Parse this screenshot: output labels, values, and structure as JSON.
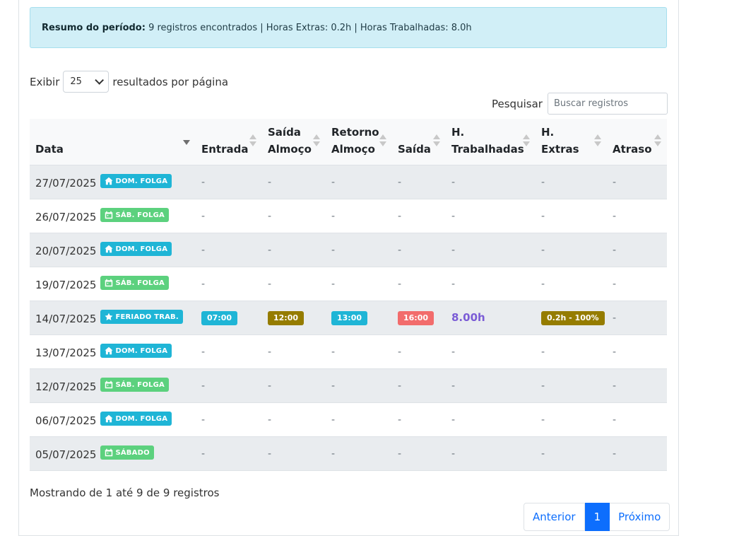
{
  "summary": {
    "label": "Resumo do período:",
    "text": " 9 registros encontrados | Horas Extras: 0.2h | Horas Trabalhadas: 8.0h"
  },
  "length_menu": {
    "before": "Exibir",
    "value": "25",
    "after": "resultados por página"
  },
  "search": {
    "label": "Pesquisar",
    "placeholder": "Buscar registros"
  },
  "columns": [
    {
      "line1": "",
      "line2": "Data"
    },
    {
      "line1": "",
      "line2": "Entrada"
    },
    {
      "line1": "Saída",
      "line2": "Almoço"
    },
    {
      "line1": "Retorno",
      "line2": "Almoço"
    },
    {
      "line1": "",
      "line2": "Saída"
    },
    {
      "line1": "H.",
      "line2": "Trabalhadas"
    },
    {
      "line1": "H.",
      "line2": "Extras"
    },
    {
      "line1": "",
      "line2": "Atraso"
    }
  ],
  "rows": [
    {
      "date": "27/07/2025",
      "tag": "DOM. FOLGA",
      "tag_icon": "home-icon",
      "tag_color": "#1fb5d6",
      "entrada": "-",
      "saida_almoco": "-",
      "retorno_almoco": "-",
      "saida": "-",
      "h_trabalhadas": "-",
      "h_extras": "-",
      "atraso": "-"
    },
    {
      "date": "26/07/2025",
      "tag": "SÁB. FOLGA",
      "tag_icon": "calendar-icon",
      "tag_color": "#5cd17e",
      "entrada": "-",
      "saida_almoco": "-",
      "retorno_almoco": "-",
      "saida": "-",
      "h_trabalhadas": "-",
      "h_extras": "-",
      "atraso": "-"
    },
    {
      "date": "20/07/2025",
      "tag": "DOM. FOLGA",
      "tag_icon": "home-icon",
      "tag_color": "#1fb5d6",
      "entrada": "-",
      "saida_almoco": "-",
      "retorno_almoco": "-",
      "saida": "-",
      "h_trabalhadas": "-",
      "h_extras": "-",
      "atraso": "-"
    },
    {
      "date": "19/07/2025",
      "tag": "SÁB. FOLGA",
      "tag_icon": "calendar-icon",
      "tag_color": "#5cd17e",
      "entrada": "-",
      "saida_almoco": "-",
      "retorno_almoco": "-",
      "saida": "-",
      "h_trabalhadas": "-",
      "h_extras": "-",
      "atraso": "-"
    },
    {
      "date": "14/07/2025",
      "tag": "FERIADO TRAB.",
      "tag_icon": "star-icon",
      "tag_color": "#1fb5d6",
      "entrada": "07:00",
      "saida_almoco": "12:00",
      "retorno_almoco": "13:00",
      "saida": "16:00",
      "h_trabalhadas": "8.00h",
      "h_extras": "0.2h - 100%",
      "atraso": "-"
    },
    {
      "date": "13/07/2025",
      "tag": "DOM. FOLGA",
      "tag_icon": "home-icon",
      "tag_color": "#1fb5d6",
      "entrada": "-",
      "saida_almoco": "-",
      "retorno_almoco": "-",
      "saida": "-",
      "h_trabalhadas": "-",
      "h_extras": "-",
      "atraso": "-"
    },
    {
      "date": "12/07/2025",
      "tag": "SÁB. FOLGA",
      "tag_icon": "calendar-icon",
      "tag_color": "#5cd17e",
      "entrada": "-",
      "saida_almoco": "-",
      "retorno_almoco": "-",
      "saida": "-",
      "h_trabalhadas": "-",
      "h_extras": "-",
      "atraso": "-"
    },
    {
      "date": "06/07/2025",
      "tag": "DOM. FOLGA",
      "tag_icon": "home-icon",
      "tag_color": "#1fb5d6",
      "entrada": "-",
      "saida_almoco": "-",
      "retorno_almoco": "-",
      "saida": "-",
      "h_trabalhadas": "-",
      "h_extras": "-",
      "atraso": "-"
    },
    {
      "date": "05/07/2025",
      "tag": "SÁBADO",
      "tag_icon": "calendar-icon",
      "tag_color": "#5cd17e",
      "entrada": "-",
      "saida_almoco": "-",
      "retorno_almoco": "-",
      "saida": "-",
      "h_trabalhadas": "-",
      "h_extras": "-",
      "atraso": "-"
    }
  ],
  "badge_colors": {
    "entrada": "#1fb5d6",
    "saida_almoco": "#957c00",
    "retorno_almoco": "#1fb5d6",
    "saida": "#f26c6c",
    "h_extras": "#957c00"
  },
  "info": "Mostrando de 1 até 9 de 9 registros",
  "pagination": {
    "prev": "Anterior",
    "current": "1",
    "next": "Próximo"
  }
}
